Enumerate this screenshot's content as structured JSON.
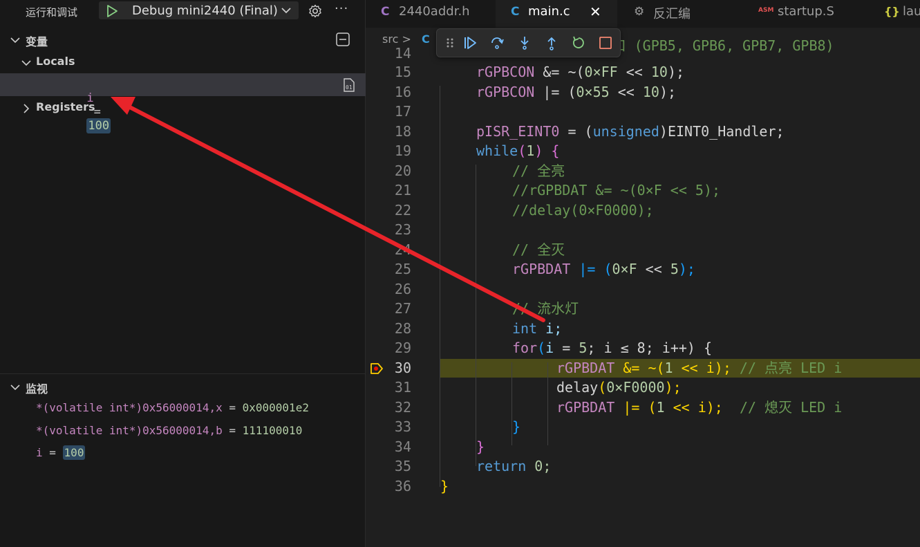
{
  "debug": {
    "title": "运行和调试",
    "config": "Debug mini2440 (Final)",
    "more": "···"
  },
  "variables": {
    "header": "变量",
    "locals_label": "Locals",
    "var_name": "i",
    "var_eq": "=",
    "var_value": "100",
    "registers_label": "Registers"
  },
  "watch": {
    "header": "监视",
    "items": [
      {
        "expr": "*(volatile int*)0x56000014,x",
        "eq": "=",
        "value": "0x000001e2"
      },
      {
        "expr": "*(volatile int*)0x56000014,b",
        "eq": "=",
        "value": "111100010"
      },
      {
        "expr": "i",
        "eq": "=",
        "value": "100"
      }
    ]
  },
  "tabs": [
    {
      "icon": "C",
      "name": "2440addr.h"
    },
    {
      "icon": "C",
      "name": "main.c",
      "close": "✕"
    },
    {
      "icon": "⚙",
      "name": "反汇编"
    },
    {
      "icon": "ASM",
      "name": "startup.S"
    },
    {
      "icon": "{}",
      "name": "lau"
    }
  ],
  "breadcrumb": {
    "folder": "src",
    "sep": ">",
    "file_icon": "C"
  },
  "editor": {
    "lines": [
      "14",
      "15",
      "16",
      "17",
      "18",
      "19",
      "20",
      "21",
      "22",
      "23",
      "24",
      "25",
      "26",
      "27",
      "28",
      "29",
      "30",
      "31",
      "32",
      "33",
      "34",
      "35",
      "36"
    ],
    "line14": "// 1. 初始化 LED 1-4端口 (GPB5, GPB6, GPB7, GPB8)",
    "l15a": "rGPBCON",
    "l15b": " &= ~(",
    "l15c": "0×FF",
    "l15d": " << ",
    "l15e": "10",
    "l15f": ");",
    "l16a": "rGPBCON",
    "l16b": " |= (",
    "l16c": "0×55",
    "l16d": " << ",
    "l16e": "10",
    "l16f": ");",
    "l18a": "pISR_EINT0",
    "l18b": " = (",
    "l18c": "unsigned",
    "l18d": ")EINT0_Handler;",
    "l19a": "while",
    "l19b": "(",
    "l19c": "1",
    "l19d": ") {",
    "l20": "// 全亮",
    "l21": "//rGPBDAT &= ~(0×F << 5);",
    "l22": "//delay(0×F0000);",
    "l24": "// 全灭",
    "l25a": "rGPBDAT",
    "l25b": " |= (",
    "l25c": "0×F",
    "l25d": " << ",
    "l25e": "5",
    "l25f": ");",
    "l27": "// 流水灯",
    "l28a": "int",
    "l28b": " i;",
    "l29a": "for",
    "l29b": "(",
    "l29c": "i",
    "l29d": " = ",
    "l29e": "5",
    "l29f": "; i ",
    "l29g": "≤",
    "l29h": " 8; i++) {",
    "l30a": "rGPBDAT",
    "l30b": " &= ~(",
    "l30c": "1",
    "l30d": " << i); ",
    "l30e": "// 点亮 LED i",
    "l31a": "delay",
    "l31b": "(",
    "l31c": "0×F0000",
    "l31d": ");",
    "l32a": "rGPBDAT",
    "l32b": " |= (",
    "l32c": "1",
    "l32d": " << i);  ",
    "l32e": "// 熄灭 LED i",
    "l33": "}",
    "l34": "}",
    "l35a": "return",
    "l35b": " 0;",
    "l36": "}"
  },
  "colors": {
    "arrow": "#e8242a",
    "highlight": "#4b4b18",
    "accent": "#3b9bd6"
  }
}
